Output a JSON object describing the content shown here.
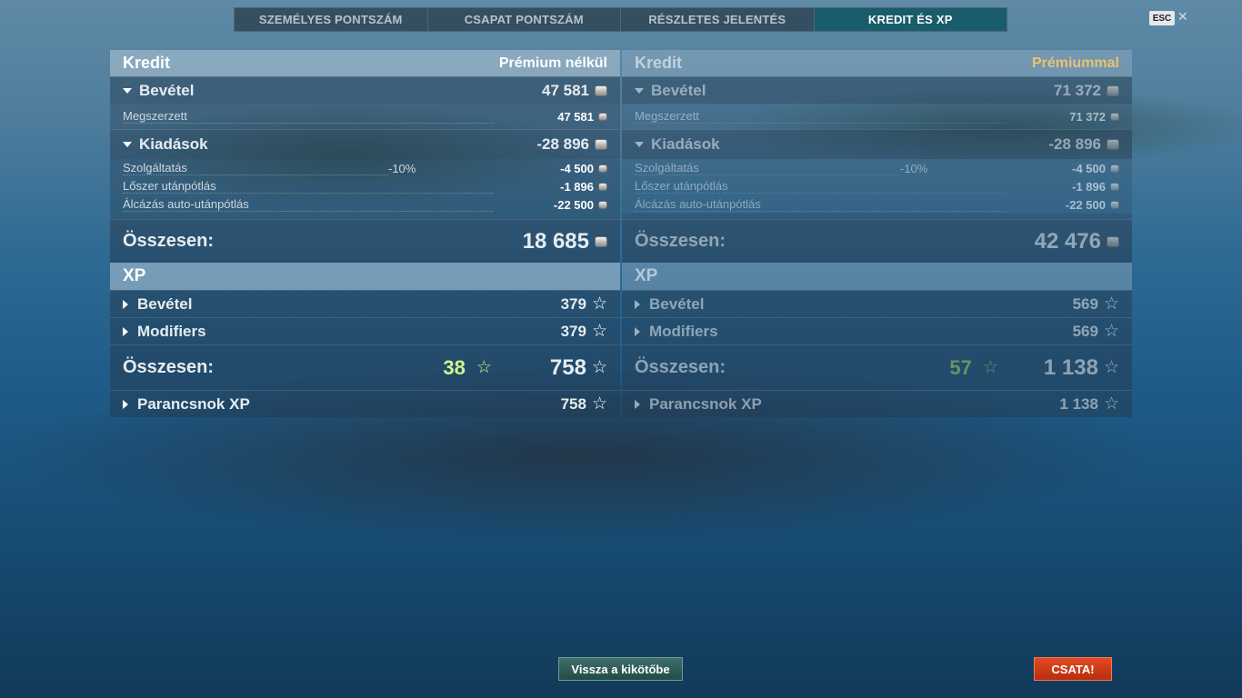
{
  "tabs": [
    {
      "label": "SZEMÉLYES PONTSZÁM",
      "active": false
    },
    {
      "label": "CSAPAT PONTSZÁM",
      "active": false
    },
    {
      "label": "RÉSZLETES JELENTÉS",
      "active": false
    },
    {
      "label": "KREDIT ÉS XP",
      "active": true
    }
  ],
  "esc": {
    "label": "ESC",
    "close": "✕"
  },
  "left": {
    "credit_title": "Kredit",
    "credit_mode": "Prémium nélkül",
    "income_label": "Bevétel",
    "income_value": "47 581",
    "earned_label": "Megszerzett",
    "earned_value": "47 581",
    "expenses_label": "Kiadások",
    "expenses_value": "-28 896",
    "service_label": "Szolgáltatás",
    "service_pct": "-10%",
    "service_value": "-4 500",
    "ammo_label": "Lőszer utánpótlás",
    "ammo_value": "-1 896",
    "camo_label": "Álcázás auto-utánpótlás",
    "camo_value": "-22 500",
    "total_label": "Összesen:",
    "total_value": "18 685",
    "xp_title": "XP",
    "xp_income_label": "Bevétel",
    "xp_income_value": "379",
    "modifiers_label": "Modifiers",
    "modifiers_value": "379",
    "xp_total_label": "Összesen:",
    "xp_free": "38",
    "xp_total_value": "758",
    "commander_label": "Parancsnok XP",
    "commander_value": "758"
  },
  "right": {
    "credit_title": "Kredit",
    "credit_mode": "Prémiummal",
    "income_label": "Bevétel",
    "income_value": "71 372",
    "earned_label": "Megszerzett",
    "earned_value": "71 372",
    "expenses_label": "Kiadások",
    "expenses_value": "-28 896",
    "service_label": "Szolgáltatás",
    "service_pct": "-10%",
    "service_value": "-4 500",
    "ammo_label": "Lőszer utánpótlás",
    "ammo_value": "-1 896",
    "camo_label": "Álcázás auto-utánpótlás",
    "camo_value": "-22 500",
    "total_label": "Összesen:",
    "total_value": "42 476",
    "xp_title": "XP",
    "xp_income_label": "Bevétel",
    "xp_income_value": "569",
    "modifiers_label": "Modifiers",
    "modifiers_value": "569",
    "xp_total_label": "Összesen:",
    "xp_free": "57",
    "xp_total_value": "1 138",
    "commander_label": "Parancsnok XP",
    "commander_value": "1 138"
  },
  "buttons": {
    "home": "Vissza a kikötőbe",
    "battle": "CSATA!"
  },
  "icons": {
    "credit": "credit-coin-icon",
    "xp": "star-icon",
    "free_xp": "star-outline-icon"
  },
  "colors": {
    "active_tab": "#145f6e",
    "battle_button": "#d63d18",
    "premium_label": "#e9c36f",
    "free_xp": "#d4f28a"
  }
}
